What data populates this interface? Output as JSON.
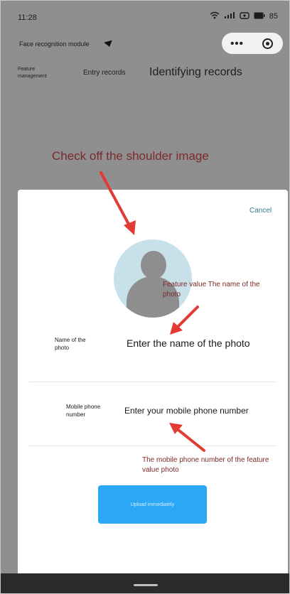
{
  "status_bar": {
    "time": "11:28",
    "icons": [
      "wifi-icon",
      "signal-icon",
      "hotspot-icon",
      "battery-icon"
    ],
    "battery": "85"
  },
  "header": {
    "app_title": "Face recognition module",
    "capsule_more": "•••"
  },
  "tabs": {
    "feature": "Feature management",
    "entry": "Entry records",
    "identify": "Identifying records"
  },
  "annotations": {
    "top": "Check off the shoulder image",
    "feature_note": "Feature value The name of the photo",
    "phone_note": "The mobile phone number of the feature value photo"
  },
  "sheet": {
    "cancel": "Cancel",
    "name_label": "Name of the photo",
    "name_value": "Enter the name of the photo",
    "phone_label": "Mobile phone number",
    "phone_value": "Enter your mobile phone number",
    "upload_button": "Upload immediately"
  },
  "colors": {
    "accent": "#2aa7f5",
    "annotation": "#7b2a2a",
    "arrow": "#e23b33",
    "backdrop": "#8f8f8f"
  }
}
